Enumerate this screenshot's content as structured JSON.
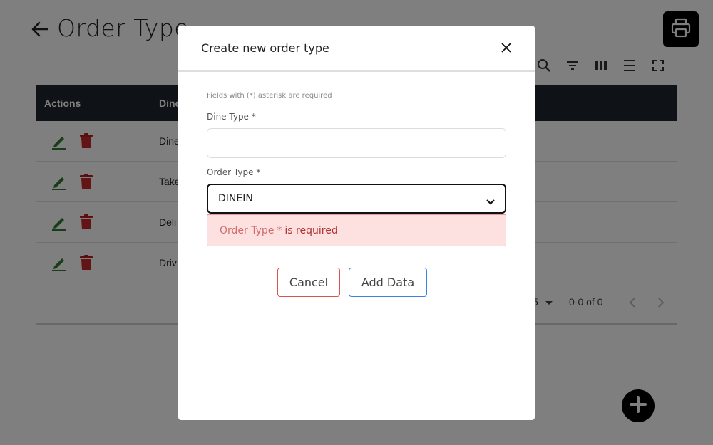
{
  "page": {
    "title": "Order Type",
    "icons": {
      "back": "arrow-left-icon",
      "print": "printer-icon",
      "add": "plus-icon"
    }
  },
  "toolbar": {
    "icons": [
      "search-icon",
      "filter-icon",
      "columns-icon",
      "density-icon",
      "fullscreen-icon"
    ]
  },
  "table": {
    "headers": {
      "actions": "Actions",
      "dine": "Dine"
    },
    "rows": [
      {
        "dine": "Dine"
      },
      {
        "dine": "Take"
      },
      {
        "dine": "Deli"
      },
      {
        "dine": "Driv"
      }
    ],
    "action_icons": [
      "edit-icon",
      "delete-icon"
    ]
  },
  "pagination": {
    "rows_per_page": "5",
    "range": "0-0 of 0"
  },
  "modal": {
    "title": "Create new order type",
    "required_note": "Fields with (*) asterisk are required",
    "dine_type_label": "Dine Type *",
    "dine_type_value": "",
    "order_type_label": "Order Type *",
    "order_type_value": "DINEIN",
    "error": {
      "field": "Order Type",
      "star": "*",
      "message": "is required"
    },
    "cancel_label": "Cancel",
    "submit_label": "Add Data"
  },
  "colors": {
    "header_bg": "#1f2631",
    "edit_icon": "#2e7d32",
    "delete_icon": "#c62828",
    "error_bg": "#fde1e1",
    "error_text": "#b03030",
    "cancel_border": "#d9534f",
    "submit_border": "#3b82e6"
  }
}
